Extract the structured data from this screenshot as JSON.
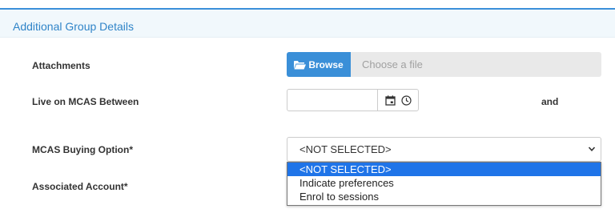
{
  "section": {
    "title": "Additional Group Details"
  },
  "fields": {
    "attachments": {
      "label": "Attachments",
      "browse_label": "Browse",
      "placeholder": "Choose a file"
    },
    "live_between": {
      "label": "Live on MCAS Between",
      "and_label": "and"
    },
    "buying_option": {
      "label": "MCAS Buying Option*",
      "selected": "<NOT SELECTED>",
      "options": [
        "<NOT SELECTED>",
        "Indicate preferences",
        "Enrol to sessions"
      ]
    },
    "associated_account": {
      "label": "Associated Account*"
    }
  },
  "colors": {
    "accent": "#3a8fd8",
    "highlight": "#1f74e8",
    "header_bg": "#f1f8fc"
  },
  "icons": [
    "folder-open-icon",
    "calendar-icon",
    "clock-icon",
    "chevron-down-icon"
  ]
}
